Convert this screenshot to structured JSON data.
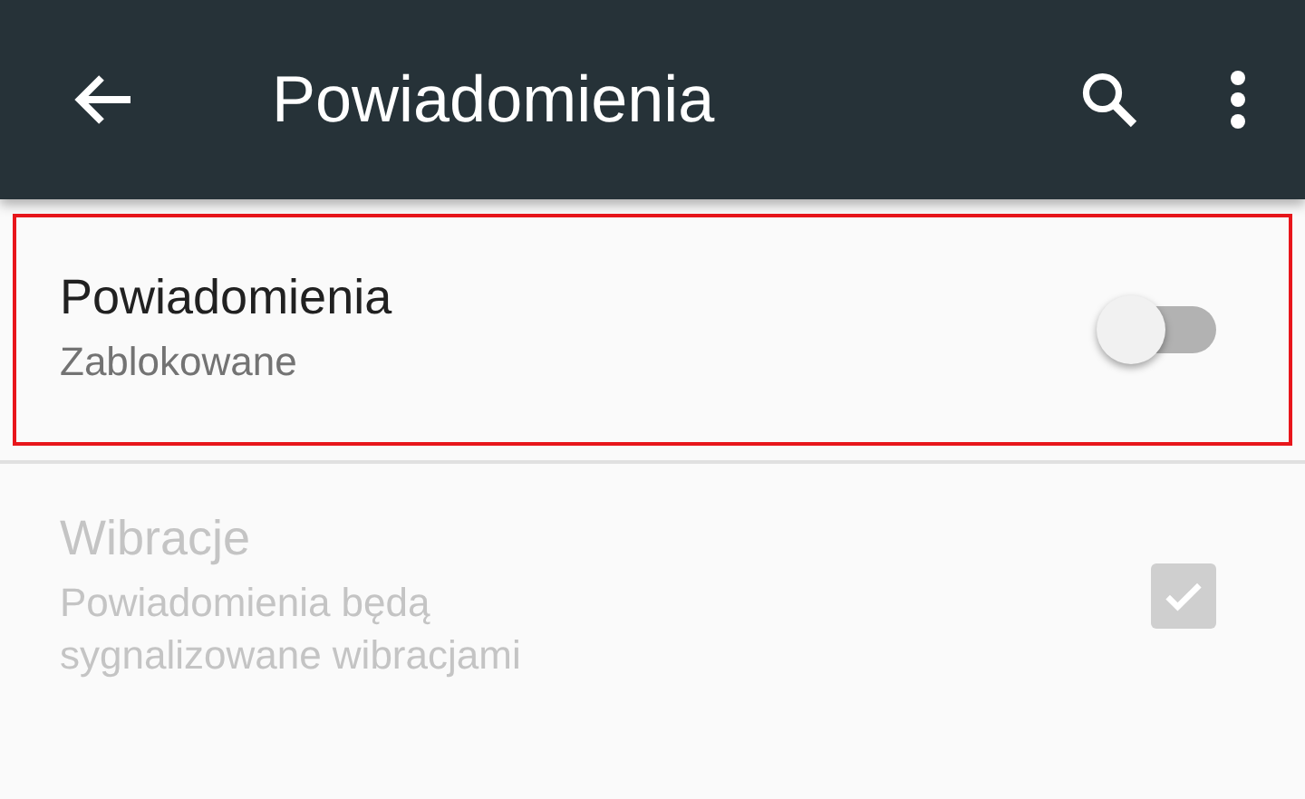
{
  "app_bar": {
    "title": "Powiadomienia"
  },
  "settings": [
    {
      "kind": "switch",
      "title": "Powiadomienia",
      "summary": "Zablokowane",
      "on": false,
      "disabled": false,
      "highlighted": true
    },
    {
      "kind": "checkbox",
      "title": "Wibracje",
      "summary": "Powiadomienia będą sygnalizowane wibracjami",
      "checked": true,
      "disabled": true,
      "highlighted": false
    }
  ]
}
